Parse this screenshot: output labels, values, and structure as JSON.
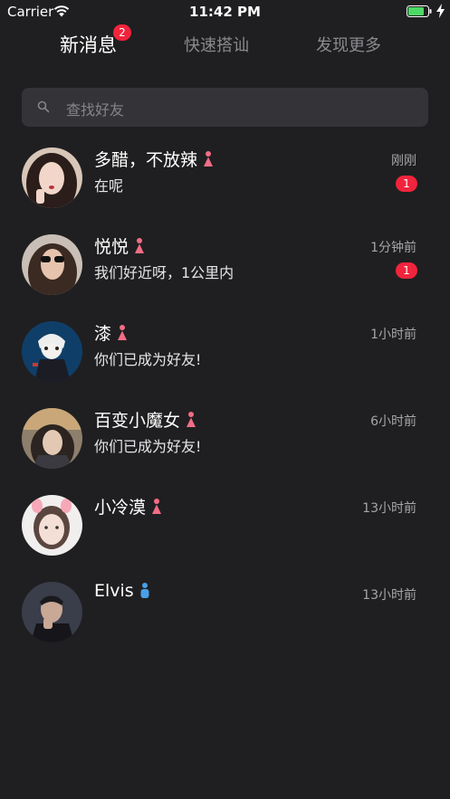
{
  "status_bar": {
    "carrier": "Carrier",
    "time": "11:42 PM"
  },
  "tabs": [
    {
      "label": "新消息",
      "badge": "2",
      "active": true
    },
    {
      "label": "快速搭讪",
      "active": false
    },
    {
      "label": "发现更多",
      "active": false
    }
  ],
  "search": {
    "placeholder": "查找好友"
  },
  "conversations": [
    {
      "name": "多醋，不放辣",
      "gender": "female",
      "message": "在呢",
      "time": "刚刚",
      "unread": "1"
    },
    {
      "name": "悦悦",
      "gender": "female",
      "message": "我们好近呀，1公里内",
      "time": "1分钟前",
      "unread": "1"
    },
    {
      "name": "漆",
      "gender": "female",
      "message": "你们已成为好友!",
      "time": "1小时前",
      "unread": ""
    },
    {
      "name": "百变小魔女",
      "gender": "female",
      "message": "你们已成为好友!",
      "time": "6小时前",
      "unread": ""
    },
    {
      "name": "小冷漠",
      "gender": "female",
      "message": "",
      "time": "13小时前",
      "unread": ""
    },
    {
      "name": "Elvis",
      "gender": "male",
      "message": "",
      "time": "13小时前",
      "unread": ""
    }
  ],
  "colors": {
    "background": "#1f1f21",
    "badge": "#f0243c",
    "female": "#f26d86",
    "male": "#4a9fe8"
  }
}
